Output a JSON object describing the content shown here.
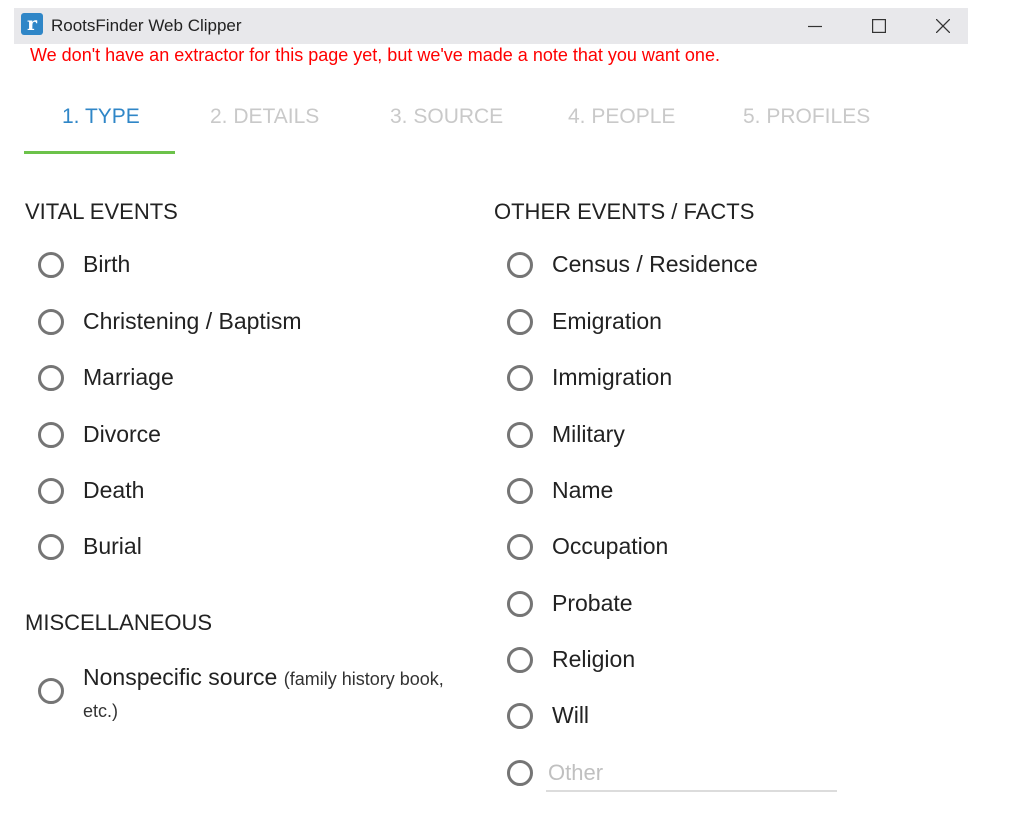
{
  "window": {
    "title": "RootsFinder Web Clipper",
    "icon_letter": "r"
  },
  "notice": "We don't have an extractor for this page yet, but we've made a note that you want one.",
  "tabs": [
    {
      "label": "1. TYPE",
      "active": true
    },
    {
      "label": "2. DETAILS",
      "active": false
    },
    {
      "label": "3. SOURCE",
      "active": false
    },
    {
      "label": "4. PEOPLE",
      "active": false
    },
    {
      "label": "5. PROFILES",
      "active": false
    }
  ],
  "vital_events": {
    "title": "VITAL EVENTS",
    "options": [
      "Birth",
      "Christening / Baptism",
      "Marriage",
      "Divorce",
      "Death",
      "Burial"
    ]
  },
  "miscellaneous": {
    "title": "MISCELLANEOUS",
    "option_main": "Nonspecific source",
    "option_hint": "(family history book, etc.)"
  },
  "other_events": {
    "title": "OTHER EVENTS / FACTS",
    "options": [
      "Census / Residence",
      "Emigration",
      "Immigration",
      "Military",
      "Name",
      "Occupation",
      "Probate",
      "Religion",
      "Will"
    ],
    "other_placeholder": "Other"
  },
  "colors": {
    "accent": "#2f86c7",
    "tab_indicator": "#6cc24a",
    "notice": "#ff0000"
  }
}
